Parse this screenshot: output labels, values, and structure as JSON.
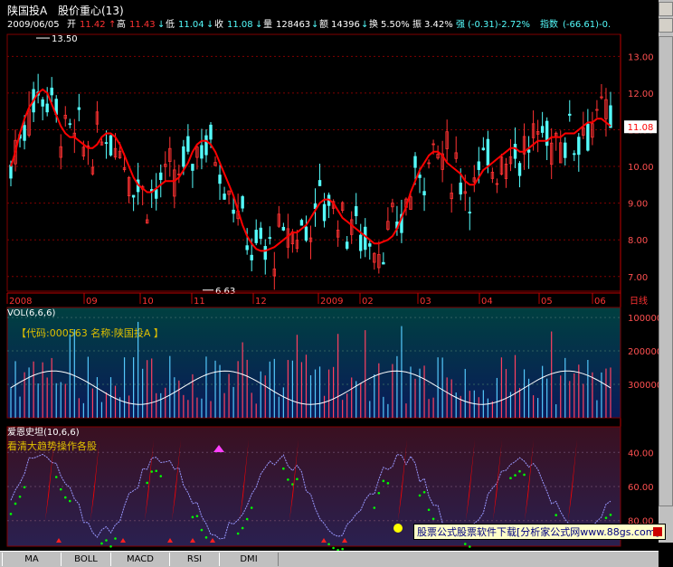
{
  "header": {
    "stock_name": "陕国投A",
    "indicator_title": "股价重心(13)",
    "date": "2009/06/05",
    "open_label": "开",
    "open_value": "11.42",
    "high_label": "高",
    "high_value": "11.43",
    "low_label": "低",
    "low_value": "11.04",
    "close_label": "收",
    "close_value": "11.08",
    "volume_label": "量",
    "volume_value": "128463",
    "amount_label": "额",
    "amount_value": "14396",
    "turnover_label": "换",
    "turnover_value": "5.50%",
    "amplitude_label": "振",
    "amplitude_value": "3.42%",
    "strength_label": "强",
    "strength_value": "(-0.31)-2.72%",
    "index_label": "指数",
    "index_value": "(-66.61)-0."
  },
  "colors": {
    "up": "#ff3232",
    "down": "#54fcfc",
    "ma": "#ff0000",
    "grid": "#800000",
    "text_white": "#ffffff",
    "text_yellow": "#ffff00",
    "green_dots": "#00ff00",
    "purple": "#9999ff"
  },
  "price_panel": {
    "annot_high": "13.50",
    "annot_low": "6.63",
    "last_price_tag": "11.08",
    "time_labels": [
      "2008",
      "09",
      "10",
      "11",
      "12",
      "2009",
      "02",
      "03",
      "04",
      "05",
      "06"
    ],
    "period_label": "日线"
  },
  "vol_panel": {
    "title": "VOL(6,6,6)",
    "info_text": "【代码:000563 名称:陕国投A 】",
    "y_ticks": [
      "300000",
      "200000",
      "100000"
    ]
  },
  "ind_panel": {
    "title": "爱恩史坦(10,6,6)",
    "subtitle": "看清大趋势操作各股",
    "y_ticks": [
      "80.00",
      "60.00",
      "40.00"
    ]
  },
  "ad_text": "股票公式股票软件下载[分析家公式网www.88gs.com]",
  "tabs": [
    "MA",
    "BOLL",
    "MACD",
    "RSI",
    "DMI"
  ],
  "chart_data": [
    {
      "type": "line",
      "title": "股价重心(13)",
      "ylim": [
        6.6,
        13.6
      ],
      "y_ticks": [
        7.0,
        8.0,
        9.0,
        10.0,
        11.0,
        12.0,
        13.0
      ],
      "annotations": [
        {
          "label": "13.50",
          "value": 13.5
        },
        {
          "label": "6.63",
          "value": 6.63
        }
      ],
      "series": [
        {
          "values": [
            10.0,
            10.4,
            10.9,
            11.3,
            11.6,
            11.8,
            12.0,
            12.1,
            12.0,
            11.7,
            11.4,
            11.1,
            10.9,
            10.8,
            10.8,
            10.7,
            10.6,
            10.5,
            10.5,
            10.6,
            10.8,
            10.9,
            10.9,
            10.8,
            10.6,
            10.3,
            10.0,
            9.7,
            9.5,
            9.4,
            9.3,
            9.3,
            9.4,
            9.5,
            9.6,
            9.6,
            9.6,
            9.7,
            9.9,
            10.1,
            10.4,
            10.6,
            10.7,
            10.7,
            10.6,
            10.4,
            10.1,
            9.8,
            9.5,
            9.2,
            8.8,
            8.4,
            8.1,
            7.9,
            7.75,
            7.7,
            7.7,
            7.75,
            7.8,
            7.9,
            8.0,
            8.1,
            8.2,
            8.2,
            8.3,
            8.4,
            8.6,
            8.8,
            9.0,
            9.1,
            9.1,
            9.0,
            8.8,
            8.6,
            8.5,
            8.4,
            8.3,
            8.2,
            8.1,
            8.0,
            7.9,
            7.9,
            7.95,
            8.0,
            8.1,
            8.3,
            8.6,
            8.9,
            9.3,
            9.6,
            9.9,
            10.1,
            10.3,
            10.4,
            10.4,
            10.3,
            10.1,
            10.0,
            9.9,
            9.8,
            9.6,
            9.5,
            9.5,
            9.7,
            9.9,
            10.0,
            10.1,
            10.2,
            10.3,
            10.4,
            10.5,
            10.5,
            10.4,
            10.4,
            10.5,
            10.6,
            10.7,
            10.7,
            10.7,
            10.8,
            10.8,
            10.8,
            10.9,
            10.9,
            10.9,
            11.0,
            11.1,
            11.2,
            11.2,
            11.3,
            11.3,
            11.2,
            11.1
          ]
        }
      ]
    },
    {
      "type": "bar",
      "title": "VOL(6,6,6)",
      "ylim": [
        0,
        330000
      ],
      "y_ticks": [
        100000,
        200000,
        300000
      ]
    },
    {
      "type": "line",
      "title": "爱恩史坦(10,6,6)",
      "ylim": [
        25,
        95
      ],
      "y_ticks": [
        40,
        60,
        80
      ]
    }
  ]
}
